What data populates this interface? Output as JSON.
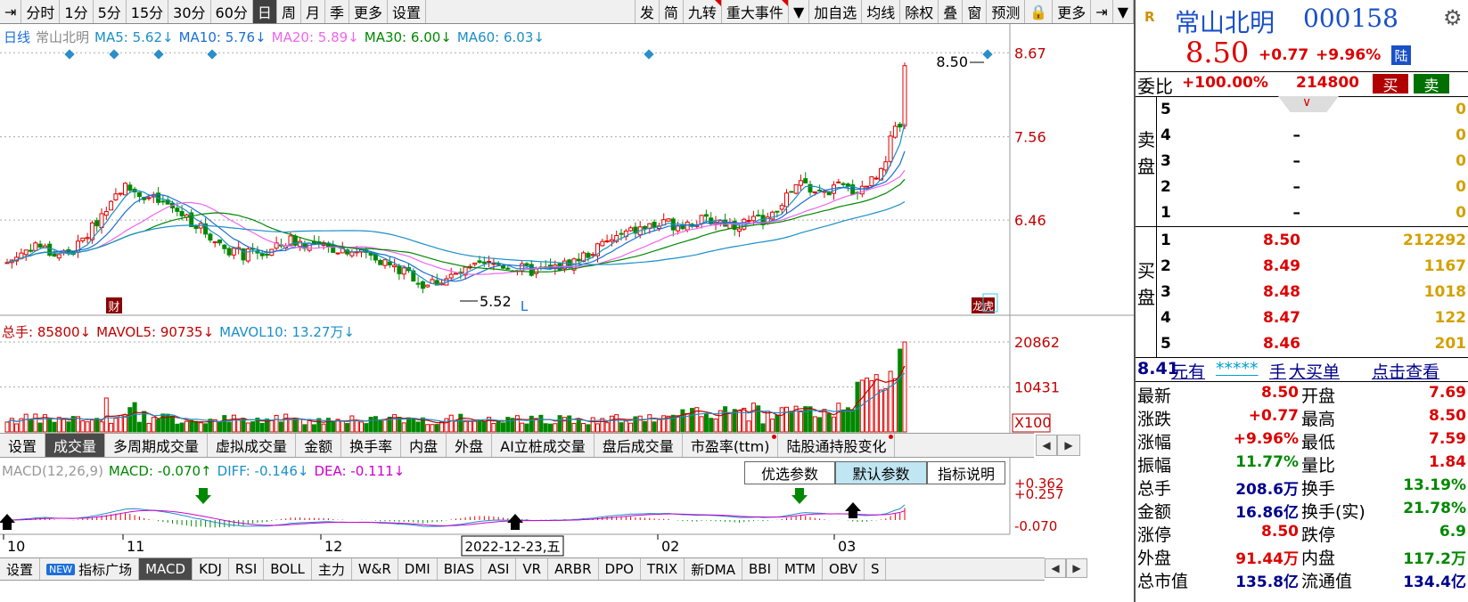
{
  "toolbar": {
    "items": [
      {
        "id": "back",
        "label": "⇥",
        "on": false,
        "flag": false
      },
      {
        "id": "intraday",
        "label": "分时",
        "on": false,
        "flag": false
      },
      {
        "id": "m1",
        "label": "1分",
        "on": false,
        "flag": false
      },
      {
        "id": "m5",
        "label": "5分",
        "on": false,
        "flag": false
      },
      {
        "id": "m15",
        "label": "15分",
        "on": false,
        "flag": false
      },
      {
        "id": "m30",
        "label": "30分",
        "on": false,
        "flag": false
      },
      {
        "id": "m60",
        "label": "60分",
        "on": false,
        "flag": false
      },
      {
        "id": "day",
        "label": "日",
        "on": true,
        "flag": false
      },
      {
        "id": "week",
        "label": "周",
        "on": false,
        "flag": false
      },
      {
        "id": "month",
        "label": "月",
        "on": false,
        "flag": false
      },
      {
        "id": "season",
        "label": "季",
        "on": false,
        "flag": false
      },
      {
        "id": "more1",
        "label": "更多",
        "on": false,
        "flag": false
      },
      {
        "id": "settings",
        "label": "设置",
        "on": false,
        "flag": false
      },
      {
        "id": "gap",
        "label": "",
        "on": false,
        "flag": false
      },
      {
        "id": "fa",
        "label": "发",
        "on": false,
        "flag": false
      },
      {
        "id": "jian",
        "label": "简",
        "on": false,
        "flag": false
      },
      {
        "id": "jiuzhuan",
        "label": "九转",
        "on": false,
        "flag": true
      },
      {
        "id": "events",
        "label": "重大事件",
        "on": false,
        "flag": true
      },
      {
        "id": "dropdown",
        "label": "▼",
        "on": false,
        "flag": false
      },
      {
        "id": "addwatch",
        "label": "加自选",
        "on": false,
        "flag": false
      },
      {
        "id": "ma",
        "label": "均线",
        "on": false,
        "flag": false
      },
      {
        "id": "exright",
        "label": "除权",
        "on": false,
        "flag": false
      },
      {
        "id": "overlay",
        "label": "叠",
        "on": false,
        "flag": false
      },
      {
        "id": "window",
        "label": "窗",
        "on": false,
        "flag": false
      },
      {
        "id": "alert",
        "label": "预测",
        "on": false,
        "flag": false
      },
      {
        "id": "lock",
        "label": "🔒",
        "on": false,
        "flag": false
      },
      {
        "id": "more2",
        "label": "更多",
        "on": false,
        "flag": false
      },
      {
        "id": "collapse",
        "label": "⇥",
        "on": false,
        "flag": false
      },
      {
        "id": "menu",
        "label": "▼",
        "on": false,
        "flag": false
      }
    ]
  },
  "main_legend": [
    {
      "text": "日线",
      "color": "#1a6ed8"
    },
    {
      "text": "常山北明",
      "color": "#888888"
    },
    {
      "text": "MA5: 5.62↓",
      "color": "#1a8fc8"
    },
    {
      "text": "MA10: 5.76↓",
      "color": "#1a6ed8"
    },
    {
      "text": "MA20: 5.89↓",
      "color": "#ee66ee"
    },
    {
      "text": "MA30: 6.00↓",
      "color": "#008800"
    },
    {
      "text": "MA60: 6.03↓",
      "color": "#1a8fc8"
    }
  ],
  "vol_legend": [
    {
      "text": "总手: 85800↓",
      "color": "#c00000"
    },
    {
      "text": "MAVOL5: 90735↓",
      "color": "#c00000"
    },
    {
      "text": "MAVOL10: 13.27万↓",
      "color": "#1a8fc8"
    }
  ],
  "macd_legend": [
    {
      "text": "MACD(12,26,9)",
      "color": "#999999"
    },
    {
      "text": "MACD: -0.070↑",
      "color": "#008800"
    },
    {
      "text": "DIFF: -0.146↓",
      "color": "#1a8fc8"
    },
    {
      "text": "DEA: -0.111↓",
      "color": "#cc00cc"
    }
  ],
  "chart_data": [
    {
      "type": "candlestick",
      "series": "daily",
      "ylim": [
        5.25,
        8.85
      ],
      "price_ticks": [
        "8.67",
        "7.56",
        "6.46"
      ],
      "x_labels": [
        "10",
        "11",
        "12",
        "02",
        "03"
      ],
      "high_label": "8.50",
      "low_label": "5.52",
      "markers": [
        "财",
        "L",
        "龙虎"
      ],
      "cursor_label": "2022-12-23,五"
    },
    {
      "type": "bar",
      "series": "volume",
      "ticks": [
        "20862",
        "10431",
        "X100"
      ]
    },
    {
      "type": "bar",
      "series": "MACD",
      "ticks": [
        "+0.362",
        "+0.257",
        "-0.070"
      ]
    }
  ],
  "vol_tabs": [
    {
      "label": "设置",
      "sel": false,
      "flag": false
    },
    {
      "label": "成交量",
      "sel": true,
      "flag": false
    },
    {
      "label": "多周期成交量",
      "sel": false,
      "flag": false
    },
    {
      "label": "虚拟成交量",
      "sel": false,
      "flag": false
    },
    {
      "label": "金额",
      "sel": false,
      "flag": false
    },
    {
      "label": "换手率",
      "sel": false,
      "flag": false
    },
    {
      "label": "内盘",
      "sel": false,
      "flag": false
    },
    {
      "label": "外盘",
      "sel": false,
      "flag": false
    },
    {
      "label": "AI立桩成交量",
      "sel": false,
      "flag": false
    },
    {
      "label": "盘后成交量",
      "sel": false,
      "flag": false
    },
    {
      "label": "市盈率(ttm)",
      "sel": false,
      "flag": true
    },
    {
      "label": "陆股通持股变化",
      "sel": false,
      "flag": true
    }
  ],
  "param_buttons": [
    {
      "label": "优选参数",
      "on": false
    },
    {
      "label": "默认参数",
      "on": true
    },
    {
      "label": "指标说明",
      "on": false
    }
  ],
  "bottom_tabs": [
    {
      "label": "设置",
      "sel": false,
      "new": false
    },
    {
      "label": "指标广场",
      "sel": false,
      "new": true
    },
    {
      "label": "MACD",
      "sel": true,
      "new": false
    },
    {
      "label": "KDJ",
      "sel": false,
      "new": false
    },
    {
      "label": "RSI",
      "sel": false,
      "new": false
    },
    {
      "label": "BOLL",
      "sel": false,
      "new": false
    },
    {
      "label": "主力",
      "sel": false,
      "new": false
    },
    {
      "label": "W&R",
      "sel": false,
      "new": false
    },
    {
      "label": "DMI",
      "sel": false,
      "new": false
    },
    {
      "label": "BIAS",
      "sel": false,
      "new": false
    },
    {
      "label": "ASI",
      "sel": false,
      "new": false
    },
    {
      "label": "VR",
      "sel": false,
      "new": false
    },
    {
      "label": "ARBR",
      "sel": false,
      "new": false
    },
    {
      "label": "DPO",
      "sel": false,
      "new": false
    },
    {
      "label": "TRIX",
      "sel": false,
      "new": false
    },
    {
      "label": "新DMA",
      "sel": false,
      "new": false
    },
    {
      "label": "BBI",
      "sel": false,
      "new": false
    },
    {
      "label": "MTM",
      "sel": false,
      "new": false
    },
    {
      "label": "OBV",
      "sel": false,
      "new": false
    },
    {
      "label": "S",
      "sel": false,
      "new": false
    }
  ],
  "new_badge": "NEW",
  "quote": {
    "r_label": "R",
    "name": "常山北明",
    "code": "000158",
    "gear": "⚙",
    "price": "8.50",
    "change": "+0.77",
    "pct": "+9.96%",
    "lu": "陆",
    "weibi_label": "委比",
    "weibi": "+100.00%",
    "weicha": "214800",
    "buy_btn": "买",
    "sell_btn": "卖",
    "sell_label": "卖盘",
    "buy_label": "买盘",
    "asks": [
      {
        "lvl": "5",
        "price": "",
        "vol": "0"
      },
      {
        "lvl": "4",
        "price": "–",
        "vol": "0"
      },
      {
        "lvl": "3",
        "price": "–",
        "vol": "0"
      },
      {
        "lvl": "2",
        "price": "–",
        "vol": "0"
      },
      {
        "lvl": "1",
        "price": "–",
        "vol": "0"
      }
    ],
    "bids": [
      {
        "lvl": "1",
        "price": "8.50",
        "vol": "212292"
      },
      {
        "lvl": "2",
        "price": "8.49",
        "vol": "1167"
      },
      {
        "lvl": "3",
        "price": "8.48",
        "vol": "1018"
      },
      {
        "lvl": "4",
        "price": "8.47",
        "vol": "122"
      },
      {
        "lvl": "5",
        "price": "8.46",
        "vol": "201"
      }
    ],
    "promo": {
      "price": "8.41",
      "yuan": "元有",
      "stars": "*****",
      "shou": "手",
      "big": "大买单",
      "click": "点击查看"
    },
    "stats": [
      {
        "l1": "最新",
        "v1": "8.50",
        "c1": "red",
        "l2": "开盘",
        "v2": "7.69",
        "c2": "red"
      },
      {
        "l1": "涨跌",
        "v1": "+0.77",
        "c1": "red",
        "l2": "最高",
        "v2": "8.50",
        "c2": "red"
      },
      {
        "l1": "涨幅",
        "v1": "+9.96%",
        "c1": "red",
        "l2": "最低",
        "v2": "7.59",
        "c2": "red"
      },
      {
        "l1": "振幅",
        "v1": "11.77%",
        "c1": "green",
        "l2": "量比",
        "v2": "1.84",
        "c2": "red"
      },
      {
        "l1": "总手",
        "v1": "208.6万",
        "c1": "navy",
        "l2": "换手",
        "v2": "13.19%",
        "c2": "green"
      },
      {
        "l1": "金额",
        "v1": "16.86亿",
        "c1": "navy",
        "l2": "换手(实)",
        "v2": "21.78%",
        "c2": "green"
      },
      {
        "l1": "涨停",
        "v1": "8.50",
        "c1": "red",
        "l2": "跌停",
        "v2": "6.9",
        "c2": "green"
      },
      {
        "l1": "外盘",
        "v1": "91.44万",
        "c1": "red",
        "l2": "内盘",
        "v2": "117.2万",
        "c2": "green"
      },
      {
        "l1": "总市值",
        "v1": "135.8亿",
        "c1": "navy",
        "l2": "流通值",
        "v2": "134.4亿",
        "c2": "navy"
      }
    ]
  }
}
